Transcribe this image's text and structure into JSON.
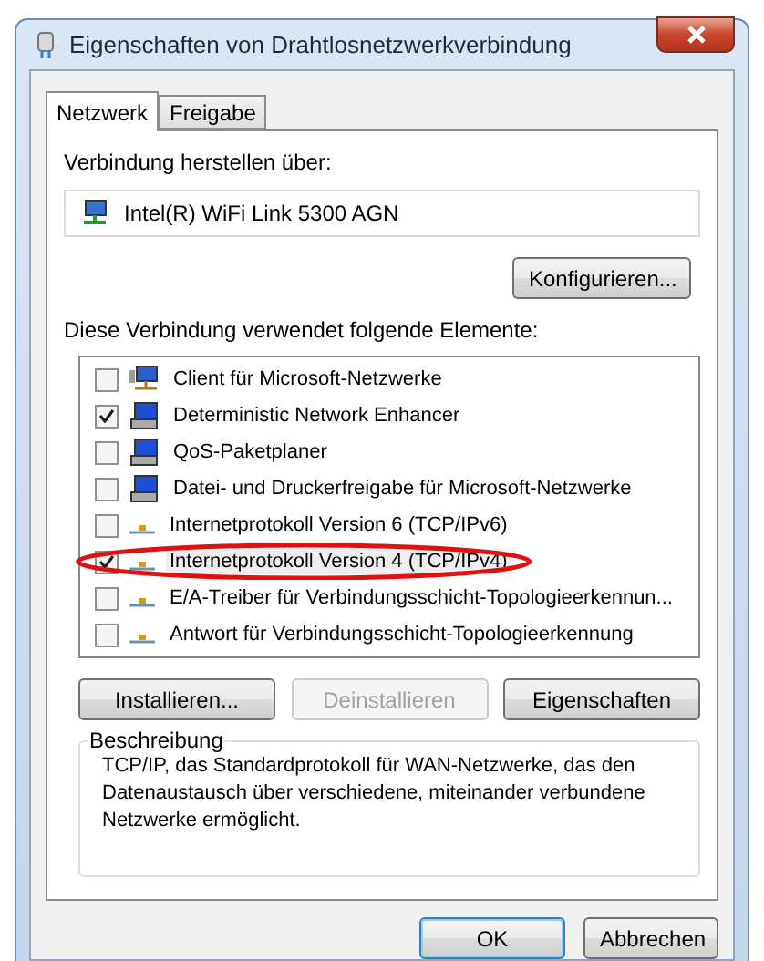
{
  "window": {
    "title": "Eigenschaften von Drahtlosnetzwerkverbindung"
  },
  "tabs": [
    {
      "label": "Netzwerk",
      "selected": true
    },
    {
      "label": "Freigabe",
      "selected": false
    }
  ],
  "connect_label": "Verbindung herstellen über:",
  "adapter": "Intel(R) WiFi Link 5300 AGN",
  "configure_button": "Konfigurieren...",
  "items_label": "Diese Verbindung verwendet folgende Elemente:",
  "items": [
    {
      "label": "Client für Microsoft-Netzwerke",
      "kind": "client",
      "checked": false,
      "selected": false,
      "highlighted": false
    },
    {
      "label": "Deterministic Network Enhancer",
      "kind": "service",
      "checked": true,
      "selected": false,
      "highlighted": false
    },
    {
      "label": "QoS-Paketplaner",
      "kind": "service",
      "checked": false,
      "selected": false,
      "highlighted": false
    },
    {
      "label": "Datei- und Druckerfreigabe für Microsoft-Netzwerke",
      "kind": "service",
      "checked": false,
      "selected": false,
      "highlighted": false
    },
    {
      "label": "Internetprotokoll Version 6 (TCP/IPv6)",
      "kind": "protocol",
      "checked": false,
      "selected": false,
      "highlighted": false
    },
    {
      "label": "Internetprotokoll Version 4 (TCP/IPv4)",
      "kind": "protocol",
      "checked": true,
      "selected": true,
      "highlighted": true
    },
    {
      "label": "E/A-Treiber für Verbindungsschicht-Topologieerkennun...",
      "kind": "protocol",
      "checked": false,
      "selected": false,
      "highlighted": false
    },
    {
      "label": "Antwort für Verbindungsschicht-Topologieerkennung",
      "kind": "protocol",
      "checked": false,
      "selected": false,
      "highlighted": false
    }
  ],
  "item_buttons": [
    {
      "label": "Installieren...",
      "disabled": false
    },
    {
      "label": "Deinstallieren",
      "disabled": true
    },
    {
      "label": "Eigenschaften",
      "disabled": false
    }
  ],
  "description": {
    "title": "Beschreibung",
    "text": "TCP/IP, das Standardprotokoll für WAN-Netzwerke, das den Datenaustausch über verschiedene, miteinander verbundene Netzwerke ermöglicht."
  },
  "dialog_buttons": [
    {
      "label": "OK",
      "default": true
    },
    {
      "label": "Abbrechen",
      "default": false
    }
  ]
}
